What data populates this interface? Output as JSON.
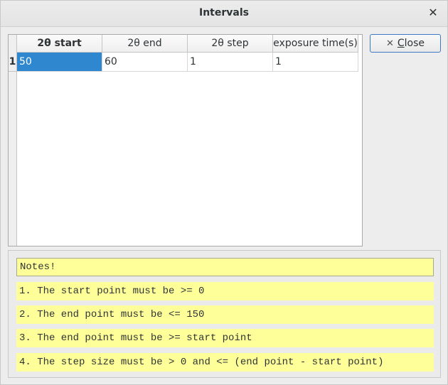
{
  "window": {
    "title": "Intervals",
    "close_glyph": "✕"
  },
  "table": {
    "columns": [
      "2θ start",
      "2θ end",
      "2θ step",
      "exposure time(s)"
    ],
    "rows": [
      {
        "index": "1",
        "cells": [
          "50",
          "60",
          "1",
          "1"
        ]
      }
    ]
  },
  "close_button": {
    "icon": "x-icon",
    "label_mnemonic": "C",
    "label_rest": "lose"
  },
  "notes": {
    "header": "Notes!",
    "items": [
      "1. The start point must be >= 0",
      "2. The end point must be <= 150",
      "3. The end point must be >= start point",
      "4. The step size must be > 0 and <= (end point - start point)"
    ]
  },
  "colors": {
    "selection": "#2f87cf",
    "note_background": "#ffff99",
    "button_focus_border": "#3c78c4"
  }
}
